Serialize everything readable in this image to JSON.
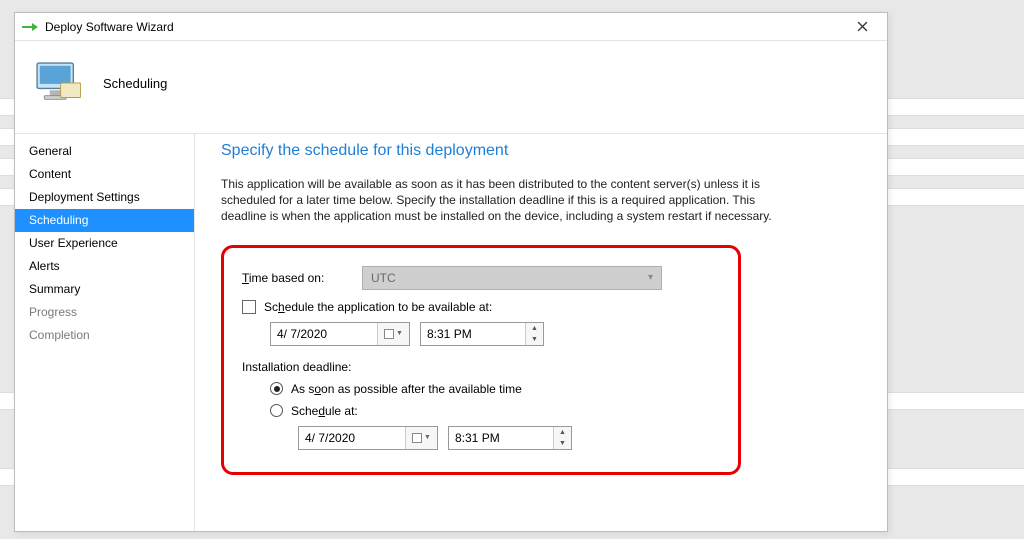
{
  "window": {
    "title": "Deploy Software Wizard",
    "header": "Scheduling"
  },
  "sidebar": {
    "items": [
      {
        "label": "General"
      },
      {
        "label": "Content"
      },
      {
        "label": "Deployment Settings"
      },
      {
        "label": "Scheduling",
        "selected": true
      },
      {
        "label": "User Experience"
      },
      {
        "label": "Alerts"
      },
      {
        "label": "Summary"
      },
      {
        "label": "Progress",
        "muted": true
      },
      {
        "label": "Completion",
        "muted": true
      }
    ]
  },
  "content": {
    "heading": "Specify the schedule for this deployment",
    "description": "This application will be available as soon as it has been distributed to the content server(s) unless it is scheduled for a later time below. Specify the installation deadline if this is a required application. This deadline is when the application must be installed on the device, including a system restart if necessary.",
    "time_based_label": "Time based on:",
    "time_based_value": "UTC",
    "schedule_available_label": "Schedule the application to be available at:",
    "available_date": "4/ 7/2020",
    "available_time": "8:31 PM",
    "deadline_label": "Installation deadline:",
    "deadline_asap_label": "As soon as possible after the available time",
    "deadline_schedule_label": "Schedule at:",
    "deadline_date": "4/ 7/2020",
    "deadline_time": "8:31 PM",
    "deadline_selected": "asap"
  }
}
